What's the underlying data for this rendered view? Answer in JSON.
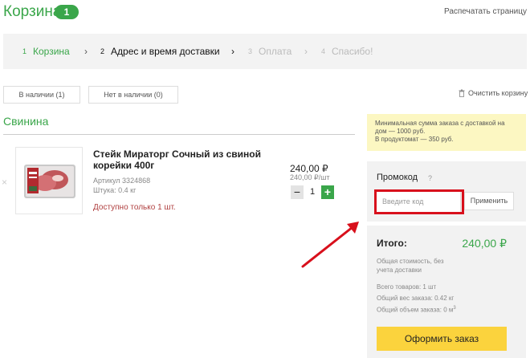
{
  "header": {
    "title": "Корзина",
    "badge": "1",
    "print_label": "Распечатать страницу"
  },
  "steps": [
    {
      "num": "1",
      "label": "Корзина",
      "state": "done"
    },
    {
      "num": "2",
      "label": "Адрес и время доставки",
      "state": "active"
    },
    {
      "num": "3",
      "label": "Оплата",
      "state": "upcoming"
    },
    {
      "num": "4",
      "label": "Спасибо!",
      "state": "upcoming"
    }
  ],
  "step_arrow": "›",
  "filters": {
    "in_stock": "В наличии (1)",
    "out_of_stock": "Нет в наличии (0)",
    "clear_cart": "Очистить корзину"
  },
  "section": {
    "title": "Свинина"
  },
  "item": {
    "remove_glyph": "×",
    "name": "Стейк Мираторг Сочный из свиной корейки 400г",
    "article": "Артикул 3324868",
    "weight": "Штука: 0.4 кг",
    "availability_note": "Доступно только 1 шт.",
    "price": "240,00 ₽",
    "unit_price": "240,00 ₽/шт",
    "qty_minus": "−",
    "quantity": "1",
    "qty_plus": "+"
  },
  "notice": {
    "line1": "Минимальная сумма заказа с доставкой на",
    "line2": "дом — 1000 руб.",
    "line3": "В продуктомат — 350 руб."
  },
  "promo": {
    "title": "Промокод",
    "help": "?",
    "placeholder": "Введите код",
    "apply_label": "Применить"
  },
  "summary": {
    "total_label": "Итого:",
    "total_value": "240,00 ₽",
    "description": "Общая стоимость, без учета доставки",
    "items_count": "Всего товаров: 1 шт",
    "total_weight": "Общий вес заказа: 0.42 кг",
    "total_volume": "Общий объем заказа: 0 м",
    "volume_exp": "3",
    "checkout_label": "Оформить заказ"
  },
  "colors": {
    "accent_green": "#3aa64a",
    "highlight_red": "#d8101c",
    "checkout_yellow": "#fbd33d",
    "notice_yellow": "#fcf7c2"
  }
}
